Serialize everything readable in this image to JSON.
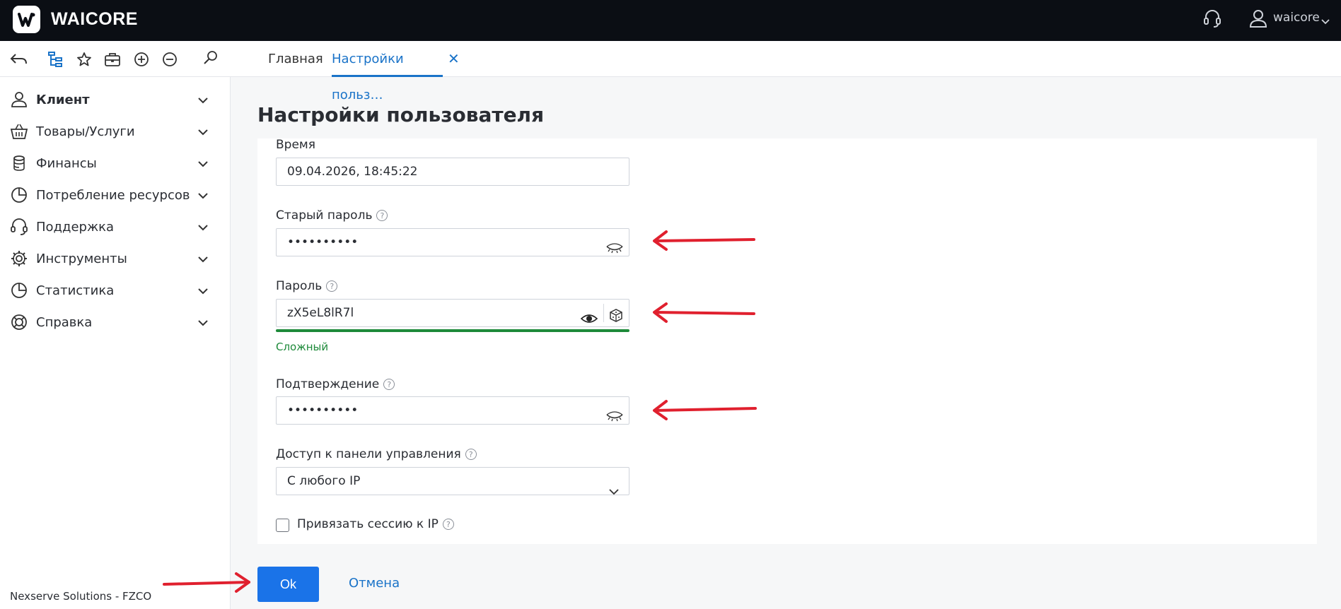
{
  "app": {
    "brand": "WAICORE",
    "user": "waicore"
  },
  "tabs": [
    {
      "label": "Главная"
    },
    {
      "label": "Настройки польз…"
    }
  ],
  "sidebar": {
    "items": [
      {
        "label": "Клиент"
      },
      {
        "label": "Товары/Услуги"
      },
      {
        "label": "Финансы"
      },
      {
        "label": "Потребление ресурсов"
      },
      {
        "label": "Поддержка"
      },
      {
        "label": "Инструменты"
      },
      {
        "label": "Статистика"
      },
      {
        "label": "Справка"
      }
    ],
    "footer": "Nexserve Solutions - FZCO"
  },
  "page": {
    "title": "Настройки пользователя"
  },
  "form": {
    "time": {
      "label": "Время",
      "value": "09.04.2026, 18:45:22"
    },
    "old_password": {
      "label": "Старый пароль",
      "value": "••••••••••"
    },
    "password": {
      "label": "Пароль",
      "value": "zX5eL8lR7l",
      "strength": "Сложный"
    },
    "confirm": {
      "label": "Подтверждение",
      "value": "••••••••••"
    },
    "access": {
      "label": "Доступ к панели управления",
      "value": "С любого IP"
    },
    "bind_session": {
      "label": "Привязать сессию к IP",
      "checked": false
    },
    "help_glyph": "?"
  },
  "buttons": {
    "ok": "Ok",
    "cancel": "Отмена"
  },
  "colors": {
    "accent": "#1a73e8",
    "topbar": "#0b0e14",
    "strength": "#1e8a3a",
    "annotation_arrow": "#e0202e"
  }
}
